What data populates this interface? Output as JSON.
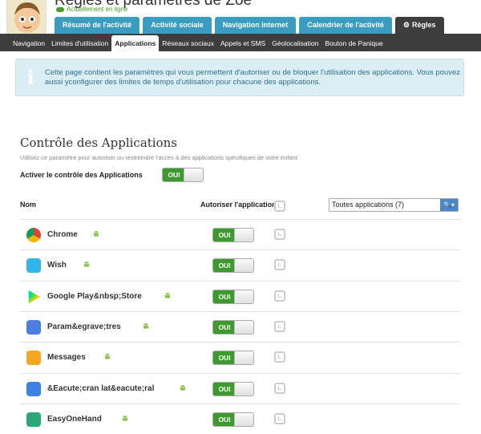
{
  "header": {
    "title": "Règles et paramètres de Zoe",
    "status": "Actuellement en ligne"
  },
  "main_tabs": [
    {
      "label": "Résumé de l'activité"
    },
    {
      "label": "Activité sociale"
    },
    {
      "label": "Navigation internet"
    },
    {
      "label": "Calendrier de l'activité"
    },
    {
      "label": "Règles",
      "icon": "gear-icon"
    }
  ],
  "sub_tabs": [
    {
      "label": "Navigation"
    },
    {
      "label": "Limites d'utilisation"
    },
    {
      "label": "Applications"
    },
    {
      "label": "Réseaux sociaux"
    },
    {
      "label": "Appels et SMS"
    },
    {
      "label": "Géolocalisation"
    },
    {
      "label": "Bouton de Panique"
    }
  ],
  "info": {
    "icon": "i",
    "text": "Cette page contient les paramètres qui vous permettent d'autoriser ou de bloquer l'utilisation des applications. Vous pouvez aussi yconfigurer des limites de temps d'utilisation pour chacune des applications."
  },
  "section": {
    "title": "Contrôle des Applications",
    "description": "Utilisez ce paramètre pour autoriser ou restreindre l'accès à des applications spécifiques de votre enfant.",
    "activate_label": "Activer le contrôle des Applications",
    "activate_toggle": "OUI"
  },
  "table": {
    "col_name": "Nom",
    "col_allow": "Autoriser l'application",
    "filter_value": "Toutes applications (7)",
    "rows": [
      {
        "name": "Chrome",
        "toggle": "OUI",
        "icon": "chrome-icon"
      },
      {
        "name": "Wish",
        "toggle": "OUI",
        "icon": "wish-icon"
      },
      {
        "name": "Google Play&nbsp;Store",
        "toggle": "OUI",
        "icon": "google-play-icon"
      },
      {
        "name": "Param&egrave;tres",
        "toggle": "OUI",
        "icon": "settings-icon"
      },
      {
        "name": "Messages",
        "toggle": "OUI",
        "icon": "messages-icon"
      },
      {
        "name": "&Eacute;cran lat&eacute;ral",
        "toggle": "OUI",
        "icon": "side-screen-icon"
      },
      {
        "name": "EasyOneHand",
        "toggle": "OUI",
        "icon": "easyonehand-icon"
      }
    ]
  },
  "colors": {
    "tab": "#3a9cc0",
    "tab_active": "#3d3d3d",
    "toggle_on": "#3e9a2e",
    "android": "#8bc34a"
  }
}
